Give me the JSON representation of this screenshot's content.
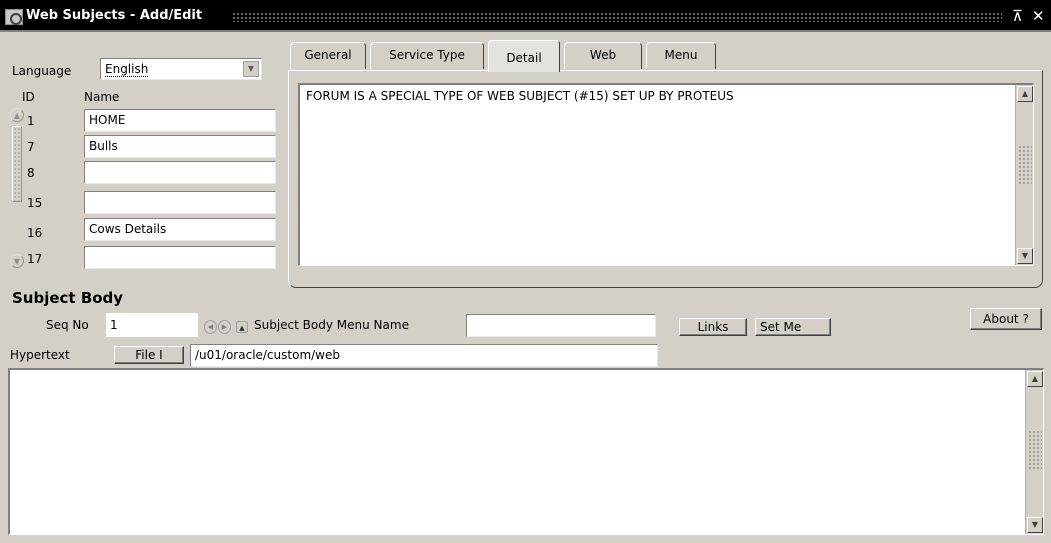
{
  "window": {
    "title": "Web Subjects - Add/Edit",
    "pin_glyph": "⊼",
    "close_glyph": "✕"
  },
  "language": {
    "label": "Language",
    "value": "English"
  },
  "list": {
    "header_id": "ID",
    "header_name": "Name",
    "rows": [
      {
        "id": "1",
        "name": "HOME"
      },
      {
        "id": "7",
        "name": "Bulls"
      },
      {
        "id": "8",
        "name": ""
      },
      {
        "id": "15",
        "name": ""
      },
      {
        "id": "16",
        "name": "Cows Details"
      },
      {
        "id": "17",
        "name": ""
      }
    ]
  },
  "tabs": [
    {
      "label": "General"
    },
    {
      "label": "Service Type"
    },
    {
      "label": "Detail"
    },
    {
      "label": "Web"
    },
    {
      "label": "Menu"
    }
  ],
  "detail": {
    "text": "FORUM IS A SPECIAL TYPE OF WEB SUBJECT (#15) SET UP BY PROTEUS"
  },
  "subject_body": {
    "title": "Subject Body",
    "seq_label": "Seq No",
    "seq_value": "1",
    "menu_name_label": "Subject Body Menu Name",
    "menu_name_value": "",
    "links_button": "Links",
    "setme_button": "Set Me",
    "about_button": "About ?",
    "hypertext_label": "Hypertext",
    "file_button": "File I",
    "path_value": "/u01/oracle/custom/web",
    "body_text": ""
  },
  "icons": {
    "up": "▲",
    "down": "▼",
    "left": "◀",
    "right": "▶",
    "collapse": "▲"
  }
}
